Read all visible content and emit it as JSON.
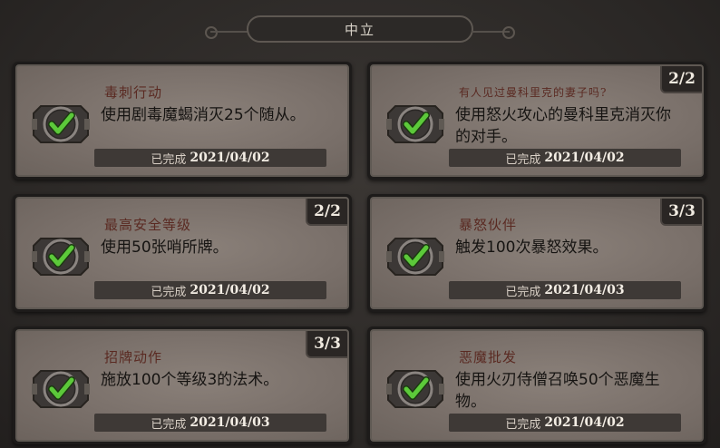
{
  "header": {
    "title": "中立"
  },
  "cards": [
    {
      "title": "毒刺行动",
      "title_small": false,
      "desc": "使用剧毒魔蝎消灭25个随从。",
      "progress": "",
      "done_label": "已完成",
      "date": "2021/04/02"
    },
    {
      "title": "有人见过曼科里克的妻子吗?",
      "title_small": true,
      "desc": "使用怒火攻心的曼科里克消灭你的对手。",
      "progress": "2/2",
      "done_label": "已完成",
      "date": "2021/04/02"
    },
    {
      "title": "最高安全等级",
      "title_small": false,
      "desc": "使用50张哨所牌。",
      "progress": "2/2",
      "done_label": "已完成",
      "date": "2021/04/02"
    },
    {
      "title": "暴怒伙伴",
      "title_small": false,
      "desc": "触发100次暴怒效果。",
      "progress": "3/3",
      "done_label": "已完成",
      "date": "2021/04/03"
    },
    {
      "title": "招牌动作",
      "title_small": false,
      "desc": "施放100个等级3的法术。",
      "progress": "3/3",
      "done_label": "已完成",
      "date": "2021/04/03"
    },
    {
      "title": "恶魔批发",
      "title_small": false,
      "desc": "使用火刃侍僧召唤50个恶魔生物。",
      "progress": "",
      "done_label": "已完成",
      "date": "2021/04/02"
    }
  ],
  "icons": {
    "completed": "checkmark-icon"
  },
  "colors": {
    "check_green": "#5cc93a",
    "title_red": "#5a2a22"
  }
}
